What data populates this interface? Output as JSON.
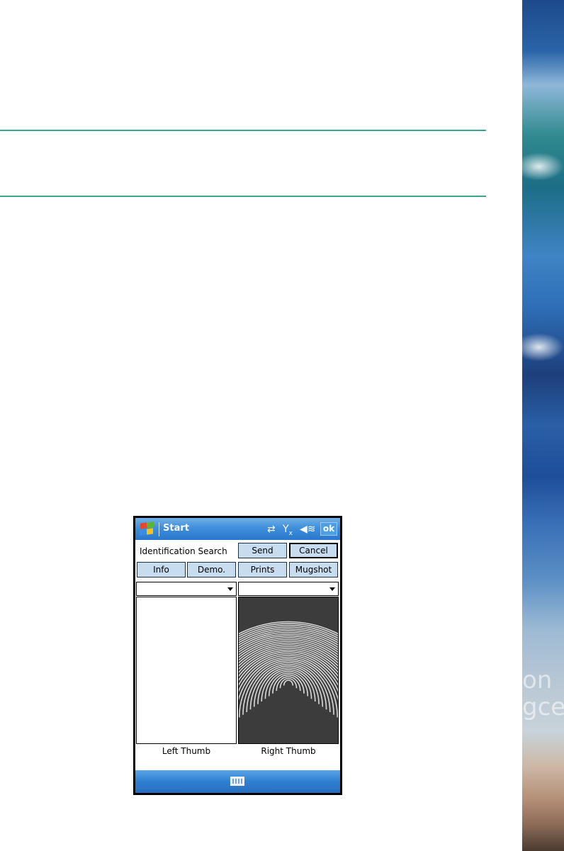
{
  "device": {
    "titlebar": {
      "title": "Start",
      "ok_label": "ok"
    },
    "form": {
      "search_label": "Identification Search",
      "send_label": "Send",
      "cancel_label": "Cancel",
      "tabs": {
        "info": "Info",
        "demo": "Demo.",
        "prints": "Prints",
        "mugshot": "Mugshot"
      },
      "left_thumb_label": "Left Thumb",
      "right_thumb_label": "Right Thumb",
      "left_dropdown_value": "",
      "right_dropdown_value": ""
    }
  },
  "decor": {
    "wave_text_1": "on",
    "wave_text_2": "gce"
  },
  "icons": [
    "windows-logo-icon",
    "sync-icon",
    "signal-off-icon",
    "volume-icon",
    "dropdown-arrow-icon",
    "keyboard-icon"
  ],
  "colors": {
    "rule": "#3aa88c",
    "titlebar": "#3f8fdc",
    "button_fill": "#c8dcf0"
  }
}
